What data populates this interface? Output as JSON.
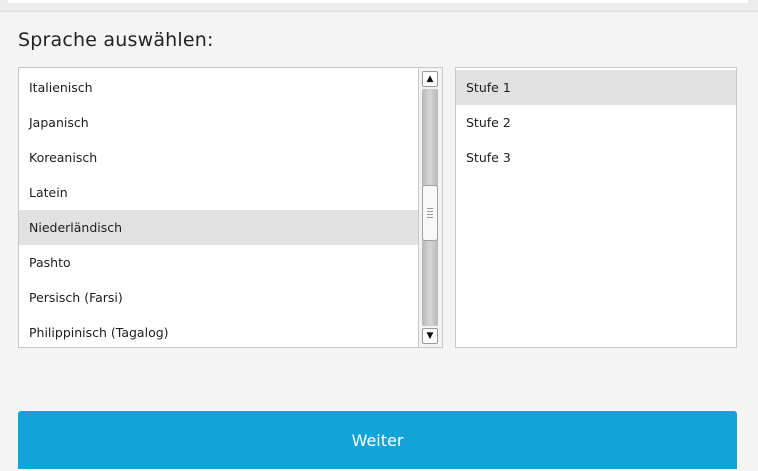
{
  "header": {
    "title": "Sprache auswählen:"
  },
  "languages": {
    "selected_index": 4,
    "items": [
      {
        "label": "Italienisch"
      },
      {
        "label": "Japanisch"
      },
      {
        "label": "Koreanisch"
      },
      {
        "label": "Latein"
      },
      {
        "label": "Niederländisch"
      },
      {
        "label": "Pashto"
      },
      {
        "label": "Persisch (Farsi)"
      },
      {
        "label": "Philippinisch (Tagalog)"
      }
    ],
    "scroll_up_glyph": "▲",
    "scroll_down_glyph": "▼"
  },
  "levels": {
    "selected_index": 0,
    "items": [
      {
        "label": "Stufe 1"
      },
      {
        "label": "Stufe 2"
      },
      {
        "label": "Stufe 3"
      }
    ]
  },
  "actions": {
    "next_label": "Weiter"
  },
  "colors": {
    "accent": "#12a3d9",
    "selection": "#e1e1e1"
  }
}
